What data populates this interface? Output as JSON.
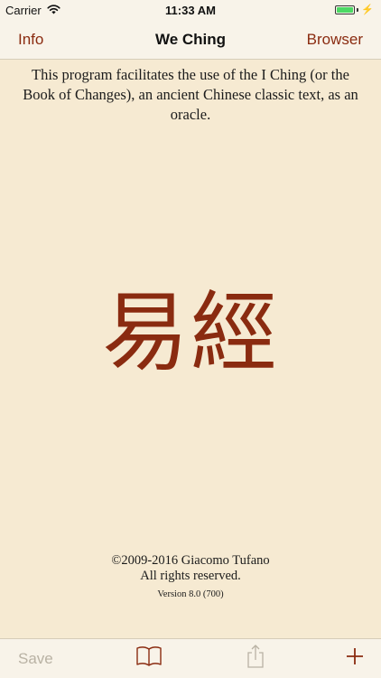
{
  "status_bar": {
    "carrier": "Carrier",
    "time": "11:33 AM",
    "battery_level": 1.0,
    "battery_color": "#4cd964"
  },
  "nav": {
    "left_label": "Info",
    "title": "We Ching",
    "right_label": "Browser",
    "accent_color": "#8a2b10"
  },
  "main": {
    "description": "This program facilitates the use of the I Ching (or the Book of Changes), an ancient Chinese classic text, as an oracle.",
    "hanzi": "易經",
    "copyright_line1": "©2009-2016 Giacomo Tufano",
    "copyright_line2": "All rights reserved.",
    "version": "Version 8.0 (700)"
  },
  "toolbar": {
    "save_label": "Save",
    "save_enabled": false,
    "book_icon": "book-icon",
    "share_icon": "share-icon",
    "add_icon": "plus-icon"
  },
  "colors": {
    "background": "#f6ead2",
    "bar_background": "#f8f3e9",
    "disabled": "#b9b2a4"
  }
}
